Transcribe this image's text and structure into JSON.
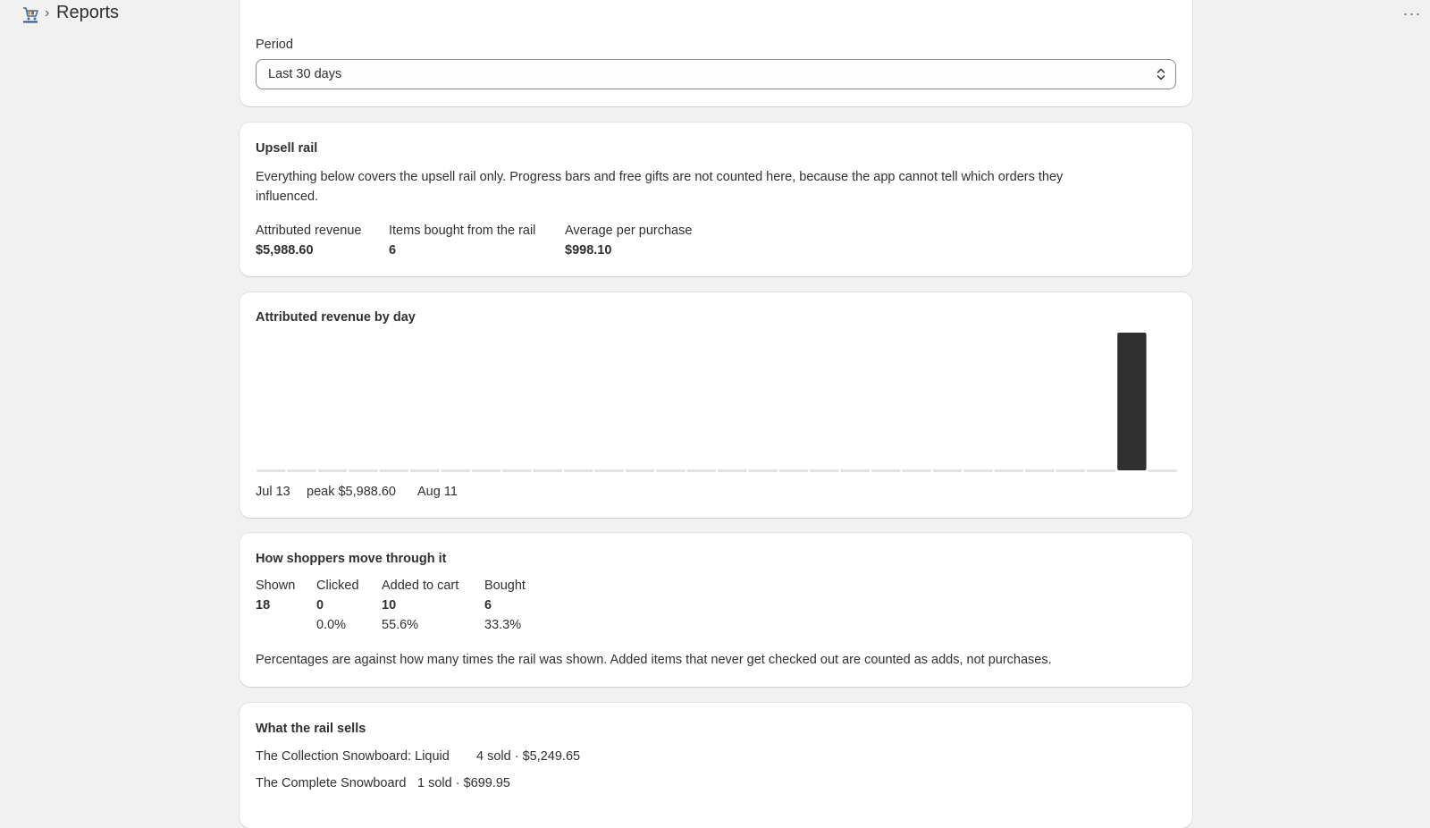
{
  "header": {
    "app_icon": "cart-icon",
    "separator": "›",
    "title": "Reports",
    "more_icon": "horizontal-dots-icon",
    "more_label": "···"
  },
  "period": {
    "label": "Period",
    "selected": "Last 30 days"
  },
  "upsell": {
    "title": "Upsell rail",
    "description": "Everything below covers the upsell rail only. Progress bars and free gifts are not counted here, because the app cannot tell which orders they influenced.",
    "stats": [
      {
        "label": "Attributed revenue",
        "value": "$5,988.60"
      },
      {
        "label": "Items bought from the rail",
        "value": "6"
      },
      {
        "label": "Average per purchase",
        "value": "$998.10"
      }
    ]
  },
  "chart_data": {
    "type": "bar",
    "title": "Attributed revenue by day",
    "start_label": "Jul 13",
    "peak_label": "peak $5,988.60",
    "end_label": "Aug 11",
    "values": [
      0,
      0,
      0,
      0,
      0,
      0,
      0,
      0,
      0,
      0,
      0,
      0,
      0,
      0,
      0,
      0,
      0,
      0,
      0,
      0,
      0,
      0,
      0,
      0,
      0,
      0,
      0,
      0,
      5988.6,
      0
    ],
    "peak": 5988.6,
    "bar_color": "#303030",
    "baseline_color": "#e3e3e3"
  },
  "funnel": {
    "title": "How shoppers move through it",
    "stages": [
      {
        "label": "Shown",
        "count": "18",
        "rate": ""
      },
      {
        "label": "Clicked",
        "count": "0",
        "rate": "0.0%"
      },
      {
        "label": "Added to cart",
        "count": "10",
        "rate": "55.6%"
      },
      {
        "label": "Bought",
        "count": "6",
        "rate": "33.3%"
      }
    ],
    "note": "Percentages are against how many times the rail was shown. Added items that never get checked out are counted as adds, not purchases."
  },
  "sells": {
    "title": "What the rail sells",
    "items": [
      {
        "name": "The Collection Snowboard: Liquid",
        "detail": "4 sold · $5,249.65"
      },
      {
        "name": "The Complete Snowboard",
        "detail": "1 sold · $699.95"
      }
    ]
  }
}
